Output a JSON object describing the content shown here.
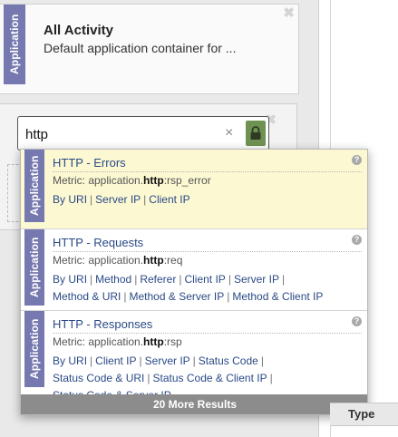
{
  "activity_card": {
    "tag": "Application",
    "title": "All Activity",
    "description": "Default application container for ..."
  },
  "search": {
    "value": "http",
    "clear_glyph": "×"
  },
  "results": [
    {
      "tag": "Application",
      "title": "HTTP - Errors",
      "metric_prefix": "Metric: application.",
      "metric_bold": "http",
      "metric_suffix": ":rsp_error",
      "by_label": "By",
      "links": [
        "URI",
        "Server IP",
        "Client IP"
      ],
      "highlighted": true
    },
    {
      "tag": "Application",
      "title": "HTTP - Requests",
      "metric_prefix": "Metric: application.",
      "metric_bold": "http",
      "metric_suffix": ":req",
      "by_label": "By",
      "links": [
        "URI",
        "Method",
        "Referer",
        "Client IP",
        "Server IP",
        "Method & URI",
        "Method & Server IP",
        "Method & Client IP"
      ],
      "highlighted": false
    },
    {
      "tag": "Application",
      "title": "HTTP - Responses",
      "metric_prefix": "Metric: application.",
      "metric_bold": "http",
      "metric_suffix": ":rsp",
      "by_label": "By",
      "links": [
        "URI",
        "Client IP",
        "Server IP",
        "Status Code",
        "Status Code & URI",
        "Status Code & Client IP",
        "Status Code & Server IP"
      ],
      "highlighted": false
    }
  ],
  "more_results": "20 More Results",
  "type_header": "Type",
  "colors": {
    "tag_bg": "#7678b0",
    "highlight_bg": "#fbf8d2",
    "link": "#2b4a86",
    "lock_bg": "#6f9253",
    "more_bar_bg": "#8c8c8c"
  }
}
